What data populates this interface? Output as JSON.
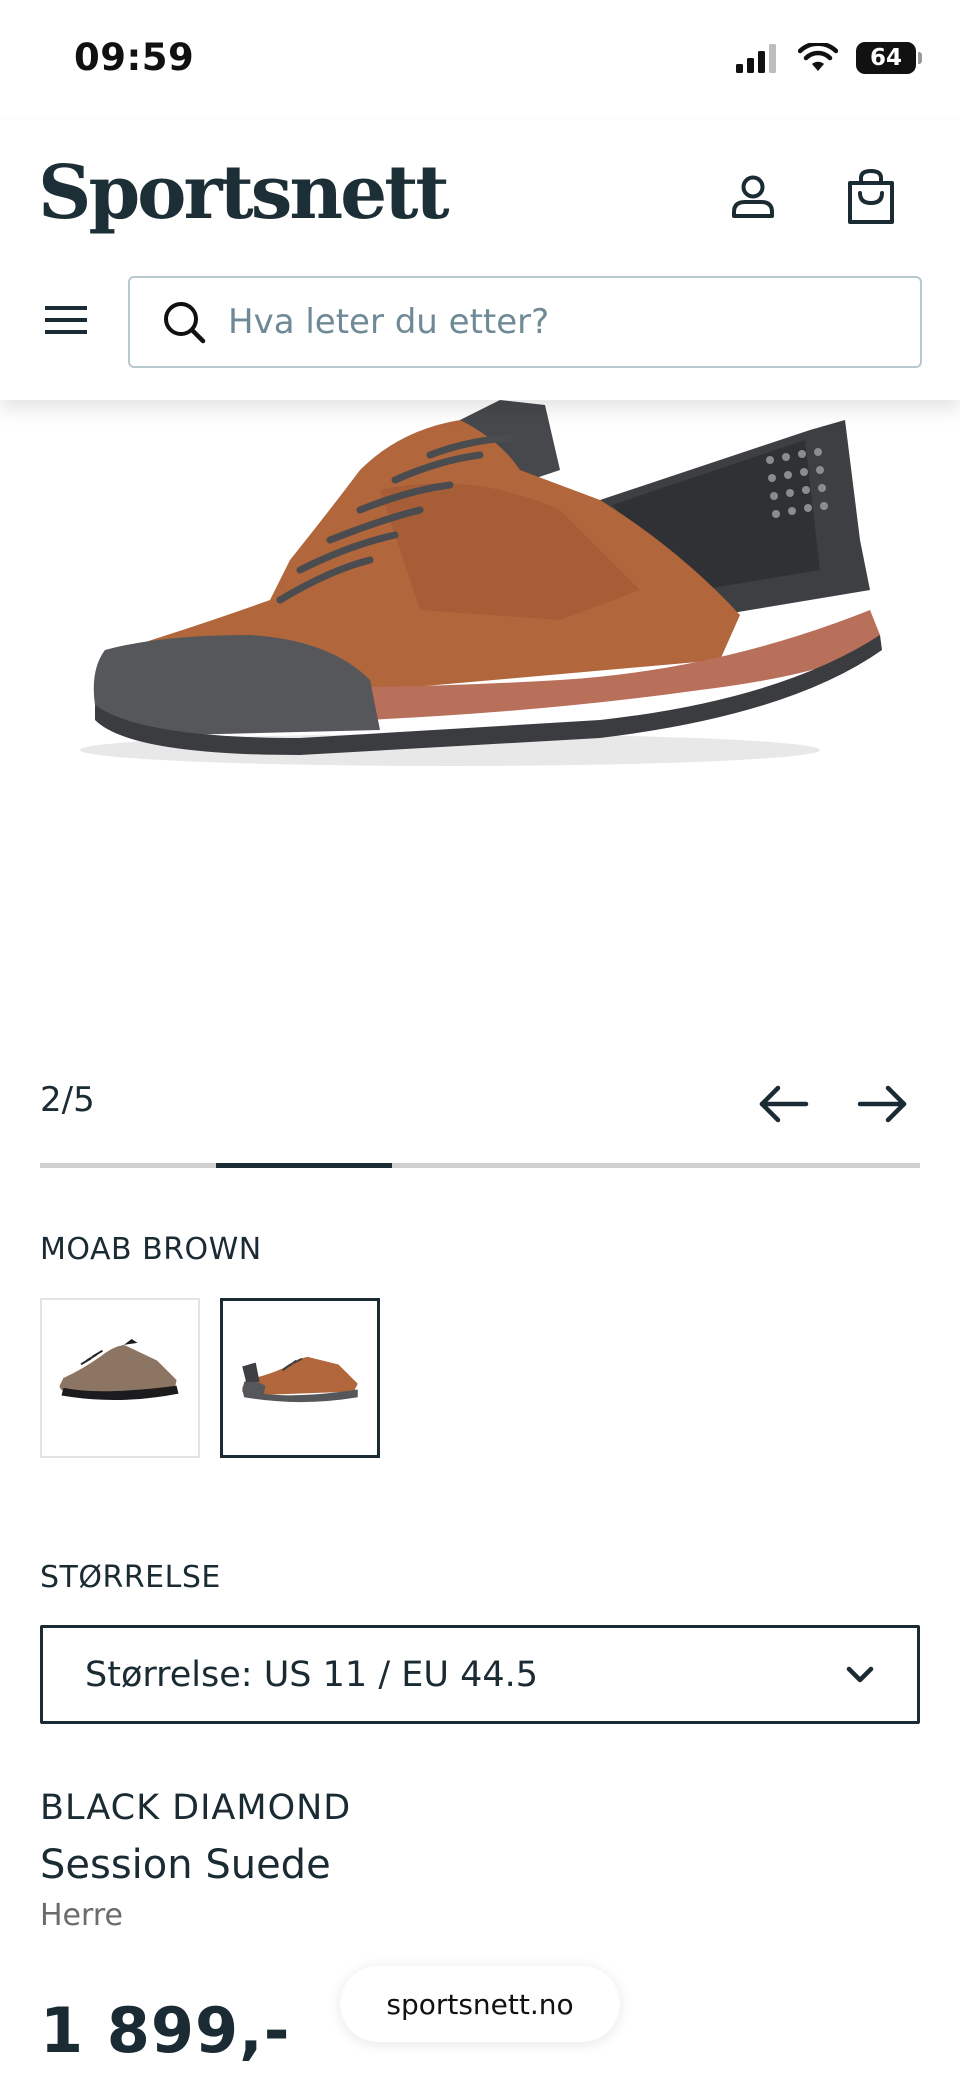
{
  "status_bar": {
    "time": "09:59",
    "battery": "64"
  },
  "header": {
    "logo": "Sportsnett",
    "search": {
      "placeholder": "Hva leter du etter?"
    }
  },
  "gallery": {
    "counter": "2/5",
    "current_index": 2,
    "total": 5
  },
  "color": {
    "label": "MOAB BROWN",
    "selected_index": 1
  },
  "size": {
    "label": "STØRRELSE",
    "selected": "Størrelse: US 11 / EU 44.5"
  },
  "product": {
    "brand": "BLACK DIAMOND",
    "name": "Session Suede",
    "gender": "Herre",
    "price": "1 899,-"
  },
  "browser": {
    "url": "sportsnett.no"
  },
  "colors": {
    "primary_text": "#1b2b33",
    "suede_brown": "#b1663c",
    "rubber_gray": "#55575a"
  }
}
